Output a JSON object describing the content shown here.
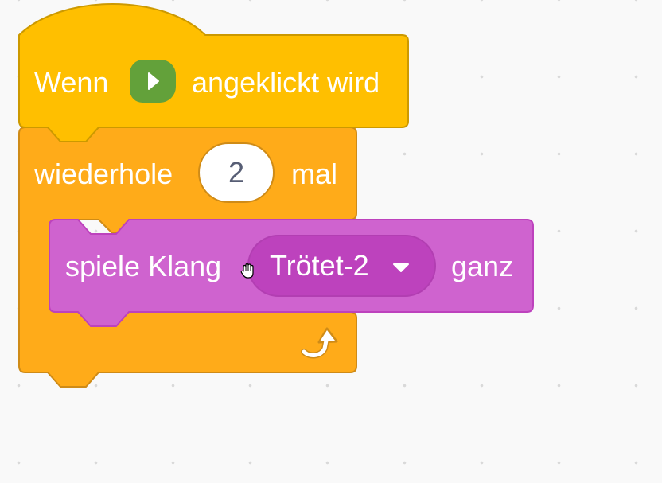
{
  "hat_block": {
    "text_before": "Wenn",
    "text_after": "angeklickt wird",
    "icon": "green-flag-play-icon",
    "color": "#ffbf00"
  },
  "repeat_block": {
    "label": "wiederhole",
    "count": "2",
    "suffix": "mal",
    "loop_icon": "repeat-arrow-icon",
    "color": "#ffab19"
  },
  "sound_block": {
    "label": "spiele Klang",
    "sound_name": "Trötet-2",
    "suffix": "ganz",
    "color": "#cf63cf"
  },
  "cursor": "hand-cursor-icon"
}
